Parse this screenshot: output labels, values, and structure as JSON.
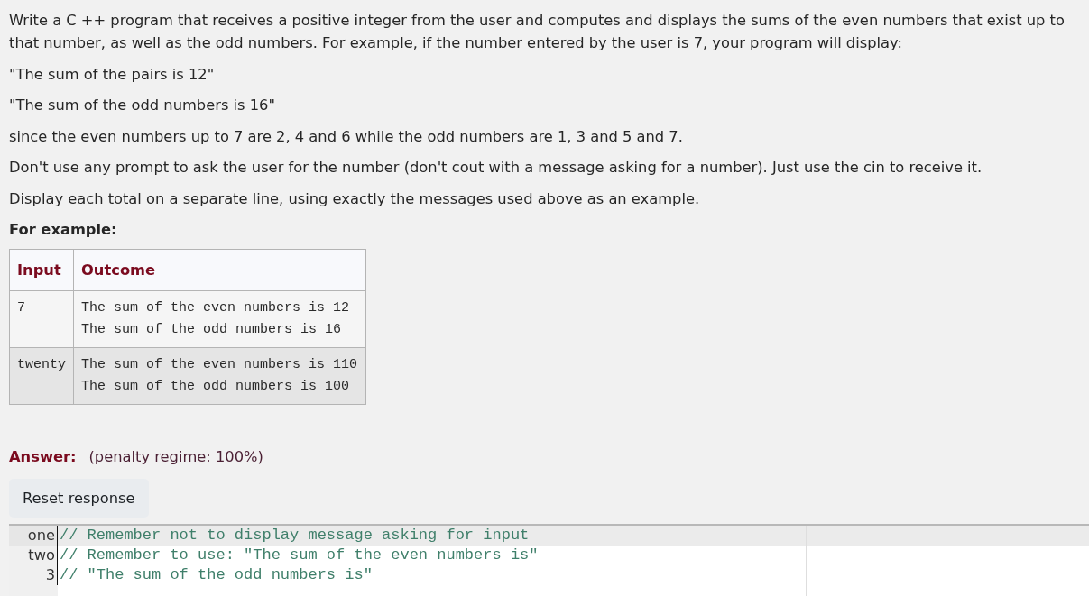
{
  "question": {
    "paragraphs": [
      "Write a C ++ program that receives a positive integer from the user and computes and displays the sums of the even numbers that exist up to that number, as well as the odd numbers. For example, if the number entered by the user is 7, your program will display:",
      "\"The sum of the pairs is 12\"",
      "\"The sum of the odd numbers is 16\"",
      "since the even numbers up to 7 are 2, 4 and 6 while the odd numbers are 1, 3 and 5 and 7.",
      "Don't use any prompt to ask the user for the number (don't cout with a message asking for a number). Just use the cin to receive it.",
      "Display each total on a separate line, using exactly the messages used above as an example."
    ],
    "example_heading": "For example:"
  },
  "example_table": {
    "columns": [
      "Input",
      "Outcome"
    ],
    "rows": [
      {
        "input": "7",
        "outcome": [
          "The sum of the even numbers is 12",
          "The sum of the odd numbers is 16"
        ]
      },
      {
        "input": "twenty",
        "outcome": [
          "The sum of the even numbers is 110",
          "The sum of the odd numbers is 100"
        ]
      }
    ]
  },
  "answer": {
    "label": "Answer:",
    "penalty": "(penalty regime: 100%)"
  },
  "reset_button": "Reset response",
  "editor": {
    "lines": [
      {
        "number": "one",
        "code": "// Remember not to display message asking for input",
        "active": true
      },
      {
        "number": "two",
        "code": "// Remember to use: \"The sum of the even numbers is\"",
        "active": false
      },
      {
        "number": "3",
        "code": "// \"The sum of the odd numbers is\"",
        "active": false
      }
    ]
  }
}
